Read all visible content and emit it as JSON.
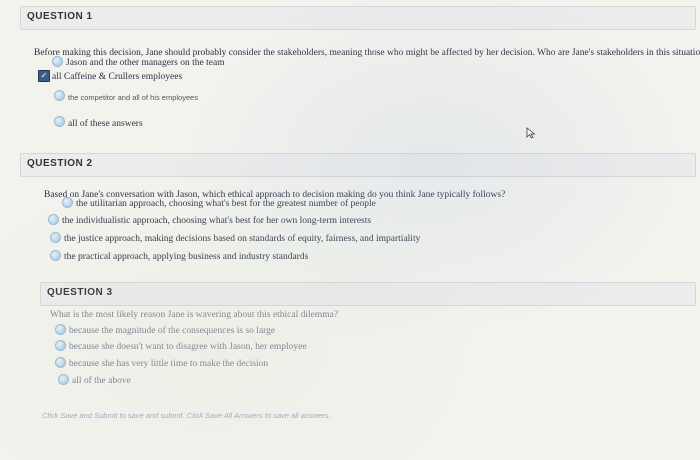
{
  "questions": [
    {
      "header": "QUESTION 1",
      "prompt": "Before making this decision, Jane should probably consider the stakeholders, meaning those who might be affected by her decision. Who are Jane's stakeholders in this situation?",
      "options": [
        "Jason and the other managers on the team",
        "all Caffeine & Crullers employees",
        "the competitor and all of his employees",
        "all of these answers"
      ]
    },
    {
      "header": "QUESTION 2",
      "prompt": "Based on Jane's conversation with Jason, which ethical approach to decision making do you think Jane typically follows?",
      "options": [
        "the utilitarian approach, choosing what's best for the greatest number of people",
        "the individualistic approach, choosing what's best for her own long-term interests",
        "the justice approach, making decisions based on standards of equity, fairness, and impartiality",
        "the practical approach, applying business and industry standards"
      ]
    },
    {
      "header": "QUESTION 3",
      "prompt": "What is the most likely reason Jane is wavering about this ethical dilemma?",
      "options": [
        "because the magnitude of the consequences is so large",
        "because she doesn't want to disagree with Jason, her employee",
        "because she has very little time to make the decision",
        "all of the above"
      ]
    }
  ],
  "footer": "Click Save and Submit to save and submit. Click Save All Answers to save all answers.",
  "icons": {
    "checkbox_mark": "✓"
  }
}
